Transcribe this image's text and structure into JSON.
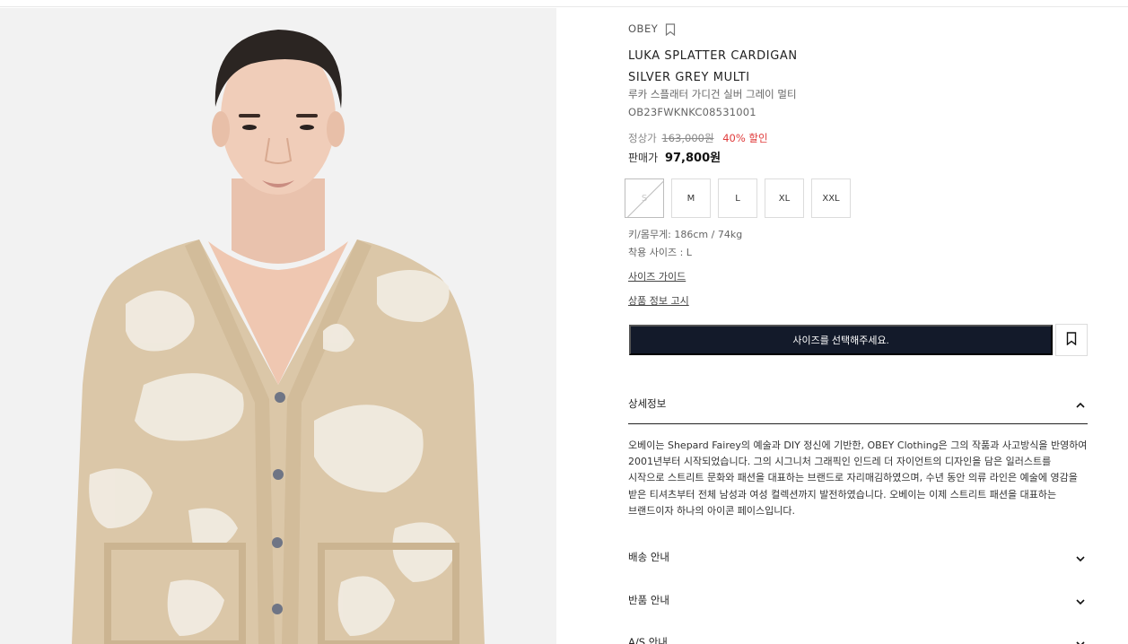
{
  "product": {
    "brand": "OBEY",
    "name_en_line1": "LUKA SPLATTER CARDIGAN",
    "name_en_line2": "SILVER GREY MULTI",
    "name_ko": "루카 스플래터 가디건 실버 그레이 멀티",
    "code": "OB23FWKNKC08531001"
  },
  "price": {
    "regular_label": "정상가",
    "regular_value": "163,000원",
    "discount": "40% 할인",
    "sale_label": "판매가",
    "sale_value": "97,800원"
  },
  "sizes": [
    {
      "label": "S",
      "soldout": true
    },
    {
      "label": "M",
      "soldout": false
    },
    {
      "label": "L",
      "soldout": false
    },
    {
      "label": "XL",
      "soldout": false
    },
    {
      "label": "XXL",
      "soldout": false
    }
  ],
  "fit": {
    "model": "키/몸무게: 186cm / 74kg",
    "worn_size": "착용 사이즈 : L"
  },
  "links": {
    "size_guide": "사이즈 가이드",
    "product_notice": "상품 정보 고시"
  },
  "cta": {
    "label": "사이즈를 선택해주세요."
  },
  "accordion": {
    "detail_title": "상세정보",
    "detail_text": "오베이는 Shepard Fairey의 예술과 DIY 정신에 기반한, OBEY Clothing은 그의 작품과 사고방식을 반영하여 2001년부터 시작되었습니다. 그의 시그니처 그래픽인 인드레 더 자이언트의 디자인을 담은 일러스트를 시작으로 스트리트 문화와 패션을 대표하는 브랜드로 자리매김하였으며, 수년 동안 의류 라인은 예술에 영감을 받은 티셔츠부터 전체 남성과 여성 컬렉션까지 발전하였습니다. 오베이는 이제 스트리트 패션을 대표하는 브랜드이자 하나의 아이콘 페이스입니다.",
    "shipping_title": "배송 안내",
    "return_title": "반품 안내",
    "as_title": "A/S 안내"
  },
  "colors": {
    "cta_bg": "#131a2a",
    "discount": "#e03c3c",
    "image_bg": "#f2f2f2",
    "cardigan": "#dbc7a8"
  },
  "icons": [
    "bookmark-icon",
    "chevron-up-icon",
    "chevron-down-icon"
  ]
}
